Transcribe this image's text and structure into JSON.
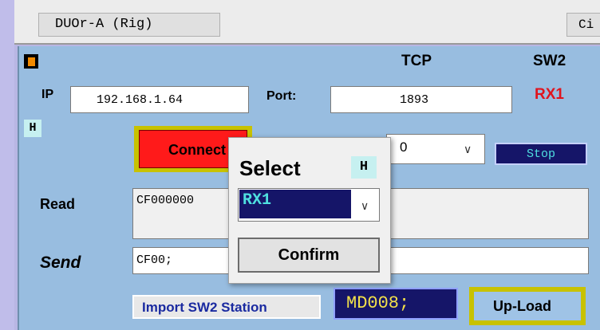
{
  "window": {
    "tab_title": "DUOr-A (Rig)",
    "tab2_title": "Ci"
  },
  "header": {
    "protocol": "TCP",
    "switch_label": "SW2",
    "switch_value": "RX1"
  },
  "connection": {
    "ip_label": "IP",
    "ip_value": "192.168.1.64",
    "port_label": "Port:",
    "port_value": "1893",
    "h_badge": "H",
    "connect_label": "Connect",
    "combo_value": "0",
    "stop_label": "Stop"
  },
  "io": {
    "read_label": "Read",
    "read_value": "CF000000",
    "send_label": "Send",
    "send_value": "CF00;"
  },
  "footer": {
    "import_label": "Import SW2 Station",
    "md_value": "MD008;",
    "upload_label": "Up-Load"
  },
  "popup": {
    "title": "Select",
    "h_badge": "H",
    "selected": "RX1",
    "confirm_label": "Confirm"
  },
  "colors": {
    "panel": "#98bde0",
    "accent_red": "#ff1a1a",
    "dark_field": "#151568",
    "cyan_text": "#4fe0e0",
    "yellow_text": "#f2e04a"
  }
}
